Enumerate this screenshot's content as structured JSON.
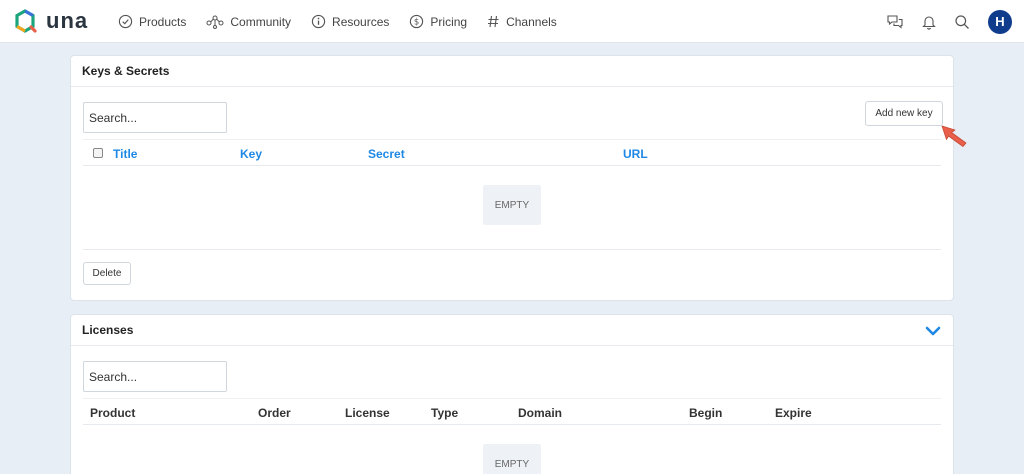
{
  "topbar": {
    "logo_text": "una",
    "nav": [
      {
        "label": "Products",
        "icon": "check-circle-icon"
      },
      {
        "label": "Community",
        "icon": "network-icon"
      },
      {
        "label": "Resources",
        "icon": "info-circle-icon"
      },
      {
        "label": "Pricing",
        "icon": "dollar-circle-icon"
      },
      {
        "label": "Channels",
        "icon": "hash-icon"
      }
    ],
    "avatar_letter": "H"
  },
  "keys_panel": {
    "title": "Keys & Secrets",
    "search_placeholder": "Search...",
    "add_button": "Add new key",
    "columns": [
      "Title",
      "Key",
      "Secret",
      "URL"
    ],
    "empty_label": "EMPTY",
    "delete_button": "Delete"
  },
  "licenses_panel": {
    "title": "Licenses",
    "search_placeholder": "Search...",
    "columns": [
      "Product",
      "Order",
      "License",
      "Type",
      "Domain",
      "Begin",
      "Expire"
    ],
    "empty_label": "EMPTY"
  },
  "colors": {
    "accent": "#1e88e5",
    "avatar": "#0f3d8c",
    "pointer": "#e8604a",
    "background": "#e8eef6"
  }
}
